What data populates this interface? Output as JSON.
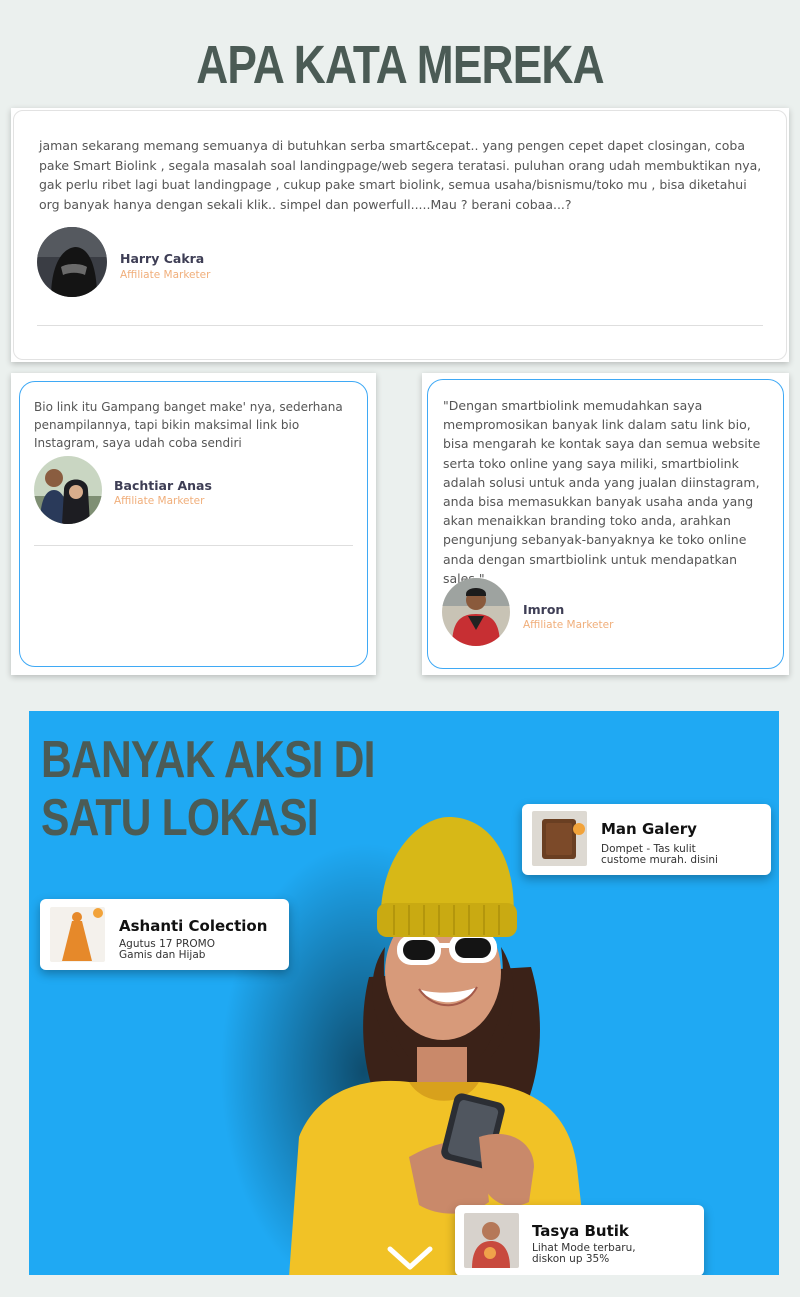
{
  "testimonials_section": {
    "heading": "APA KATA MEREKA",
    "items": [
      {
        "quote": "jaman sekarang memang semuanya di butuhkan serba smart&cepat.. yang pengen cepet dapet closingan, coba pake Smart Biolink , segala masalah soal landingpage/web segera teratasi. puluhan orang udah membuktikan nya, gak perlu ribet lagi buat landingpage , cukup pake smart biolink, semua usaha/bisnismu/toko mu , bisa diketahui org banyak hanya dengan sekali klik.. simpel dan powerfull.....Mau ? berani cobaa...?",
        "name": "Harry Cakra",
        "role": "Affiliate Marketer"
      },
      {
        "quote": "Bio link itu Gampang banget make' nya, sederhana penampilannya, tapi bikin maksimal link bio Instagram, saya udah coba sendiri",
        "name": "Bachtiar Anas",
        "role": "Affiliate Marketer"
      },
      {
        "quote": "\"Dengan smartbiolink memudahkan saya mempromosikan banyak link dalam satu link bio, bisa mengarah ke kontak saya dan semua website serta toko online yang saya miliki, smartbiolink adalah solusi untuk anda yang jualan diinstagram, anda bisa memasukkan banyak usaha anda yang akan menaikkan branding toko anda, arahkan pengunjung sebanyak-banyaknya ke toko online anda dengan smartbiolink untuk mendapatkan sales.\"",
        "name": "Imron",
        "role": "Affiliate Marketer"
      }
    ]
  },
  "promo_section": {
    "title_line1": "BANYAK AKSI DI",
    "title_line2": "SATU LOKASI",
    "shops": [
      {
        "name": "Man Galery",
        "desc_line1": "Dompet - Tas kulit",
        "desc_line2": "custome murah. disini"
      },
      {
        "name": "Ashanti Colection",
        "desc_line1": "Agutus 17 PROMO",
        "desc_line2": "Gamis dan Hijab"
      },
      {
        "name": "Tasya Butik",
        "desc_line1": "Lihat Mode terbaru,",
        "desc_line2": "diskon up 35%"
      }
    ],
    "icons": {
      "scroll": "chevron-down-icon"
    }
  },
  "colors": {
    "heading": "#4b5b55",
    "promo_background": "#1fa9f3",
    "card_border_accent": "#3fa9f5",
    "role_text": "#f0ae7a",
    "beanie": "#d7b817",
    "shirt": "#f1c226"
  }
}
